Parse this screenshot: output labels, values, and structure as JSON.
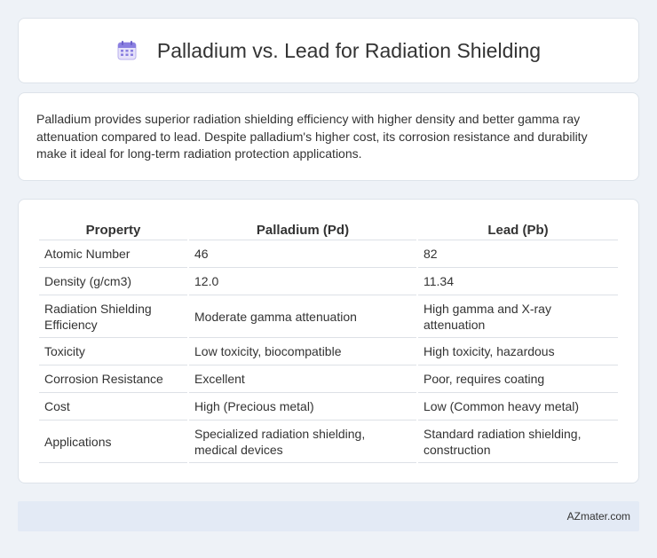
{
  "header": {
    "title": "Palladium vs. Lead for Radiation Shielding",
    "icon": "calendar-icon"
  },
  "summary": {
    "text": "Palladium provides superior radiation shielding efficiency with higher density and better gamma ray attenuation compared to lead. Despite palladium's higher cost, its corrosion resistance and durability make it ideal for long-term radiation protection applications."
  },
  "table": {
    "headers": [
      "Property",
      "Palladium (Pd)",
      "Lead (Pb)"
    ],
    "rows": [
      [
        "Atomic Number",
        "46",
        "82"
      ],
      [
        "Density (g/cm3)",
        "12.0",
        "11.34"
      ],
      [
        "Radiation Shielding Efficiency",
        "Moderate gamma attenuation",
        "High gamma and X-ray attenuation"
      ],
      [
        "Toxicity",
        "Low toxicity, biocompatible",
        "High toxicity, hazardous"
      ],
      [
        "Corrosion Resistance",
        "Excellent",
        "Poor, requires coating"
      ],
      [
        "Cost",
        "High (Precious metal)",
        "Low (Common heavy metal)"
      ],
      [
        "Applications",
        "Specialized radiation shielding, medical devices",
        "Standard radiation shielding, construction"
      ]
    ]
  },
  "footer": {
    "brand": "AZmater.com"
  },
  "colors": {
    "background": "#eef2f7",
    "card": "#ffffff",
    "footer_bar": "#e3eaf5",
    "icon_accent": "#7b6fd6"
  }
}
